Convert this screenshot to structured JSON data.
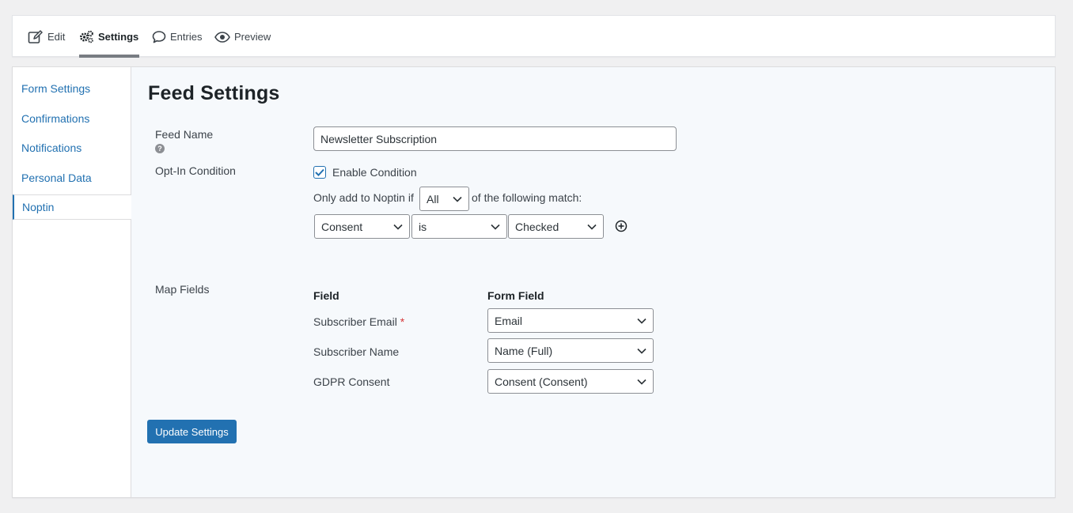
{
  "toolbar": {
    "edit": "Edit",
    "settings": "Settings",
    "entries": "Entries",
    "preview": "Preview",
    "icons": [
      "edit-icon",
      "gear-icon",
      "speech-bubble-icon",
      "eye-icon"
    ]
  },
  "sidebar": {
    "items": [
      {
        "label": "Form Settings"
      },
      {
        "label": "Confirmations"
      },
      {
        "label": "Notifications"
      },
      {
        "label": "Personal Data"
      },
      {
        "label": "Noptin"
      }
    ]
  },
  "main": {
    "title": "Feed Settings",
    "feed_name": {
      "label": "Feed Name",
      "value": "Newsletter Subscription"
    },
    "optin": {
      "label": "Opt-In Condition",
      "enable_label": "Enable Condition",
      "enabled": true,
      "prefix": "Only add to Noptin if",
      "match_value": "All",
      "suffix": "of the following match:",
      "rule": {
        "field": "Consent",
        "operator": "is",
        "value": "Checked"
      }
    },
    "map_fields": {
      "label": "Map Fields",
      "col_field": "Field",
      "col_form_field": "Form Field",
      "rows": [
        {
          "field": "Subscriber Email",
          "required": "*",
          "value": "Email"
        },
        {
          "field": "Subscriber Name",
          "value": "Name (Full)"
        },
        {
          "field": "GDPR Consent",
          "value": "Consent (Consent)"
        }
      ]
    },
    "update_button": "Update Settings"
  },
  "colors": {
    "accent": "#2271b1",
    "required": "#d63638"
  }
}
